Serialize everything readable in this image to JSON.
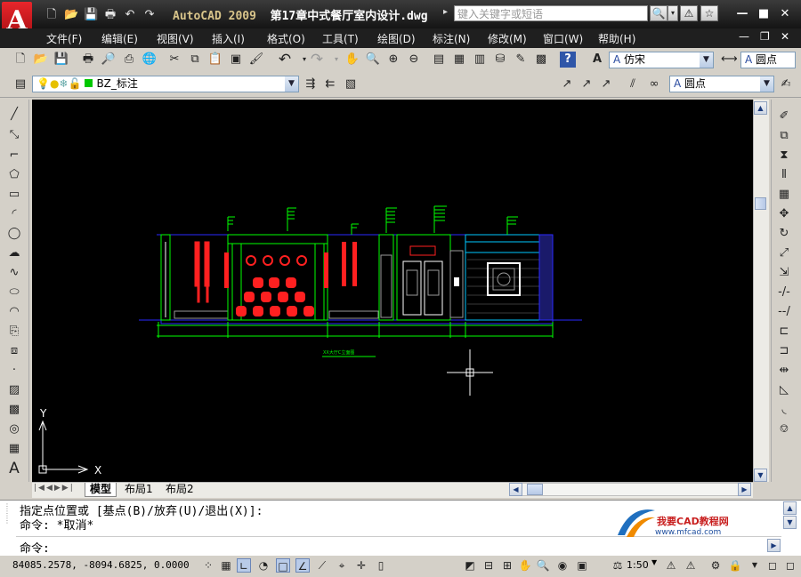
{
  "titlebar": {
    "app_title": "AutoCAD 2009",
    "file_title": "第17章中式餐厅室内设计.dwg",
    "search_placeholder": "键入关键字或短语",
    "logo_letter": "A"
  },
  "menu": [
    "文件(F)",
    "编辑(E)",
    "视图(V)",
    "插入(I)",
    "格式(O)",
    "工具(T)",
    "绘图(D)",
    "标注(N)",
    "修改(M)",
    "窗口(W)",
    "帮助(H)"
  ],
  "toolbar": {
    "text_style": "仿宋",
    "dim_style": "圆点",
    "layer_name": "BZ_标注",
    "multileader_style": "圆点"
  },
  "drawing": {
    "caption": "XX大厅C立面图",
    "ucs_y": "Y",
    "ucs_x": "X",
    "colors": {
      "green": "#00ff00",
      "red": "#ff2020",
      "white": "#ffffff",
      "cyan": "#00c8ff",
      "blue": "#2a2aff",
      "grey": "#9a9a9a"
    }
  },
  "tabs": [
    "模型",
    "布局1",
    "布局2"
  ],
  "command": {
    "line1": "指定点位置或 [基点(B)/放弃(U)/退出(X)]:",
    "line2": "命令: *取消*",
    "prompt": "命令:",
    "watermark_title": "我要CAD教程网",
    "watermark_url": "www.mfcad.com"
  },
  "status": {
    "coords": "84085.2578,  -8094.6825, 0.0000",
    "scale": "1:50"
  }
}
